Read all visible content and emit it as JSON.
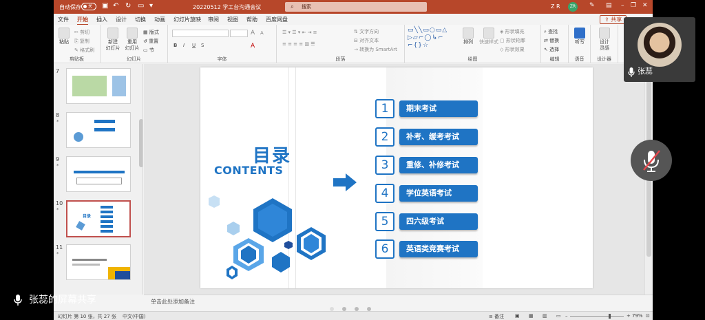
{
  "window": {
    "autosave_label": "自动保存",
    "autosave_state": "关",
    "doc_title": "20220512 学工台沟通会议",
    "search_placeholder": "搜索",
    "user_initials": "Z R",
    "avatar_initials": "ZR"
  },
  "tabs": [
    "文件",
    "开始",
    "插入",
    "设计",
    "切换",
    "动画",
    "幻灯片放映",
    "审阅",
    "视图",
    "帮助",
    "百度网盘"
  ],
  "active_tab": "开始",
  "share_label": "共享",
  "ribbon": {
    "clipboard": {
      "name": "剪贴板",
      "paste": "粘贴",
      "cut": "剪切",
      "copy": "复制",
      "format_painter": "格式刷"
    },
    "slides": {
      "name": "幻灯片",
      "new_slide": "新建\n幻灯片",
      "reuse": "重用\n幻灯片",
      "layout": "版式",
      "reset": "重置",
      "section": "节"
    },
    "font": {
      "name": "字体",
      "bold": "B",
      "italic": "I",
      "underline": "U",
      "strike": "S",
      "grow": "A",
      "shrink": "A"
    },
    "paragraph": {
      "name": "段落",
      "direction": "文字方向",
      "align": "对齐文本",
      "smartart": "转换为 SmartArt"
    },
    "drawing": {
      "name": "绘图",
      "arrange": "排列",
      "quick_styles": "快速样式",
      "fill": "形状填充",
      "outline": "形状轮廓",
      "effects": "形状效果"
    },
    "editing": {
      "name": "编辑",
      "find": "查找",
      "replace": "替换",
      "select": "选择"
    },
    "voice": {
      "name": "语音",
      "dictate": "听写"
    },
    "designer": {
      "name": "设计器",
      "ideas": "设计\n灵感"
    }
  },
  "thumbnails": [
    {
      "num": "7",
      "star": ""
    },
    {
      "num": "8",
      "star": "*"
    },
    {
      "num": "9",
      "star": "*"
    },
    {
      "num": "10",
      "star": "*"
    },
    {
      "num": "11",
      "star": "*"
    }
  ],
  "slide": {
    "title": "目录",
    "subtitle": "CONTENTS",
    "items": [
      {
        "num": "1",
        "label": "期末考试"
      },
      {
        "num": "2",
        "label": "补考、缓考考试"
      },
      {
        "num": "3",
        "label": "重修、补修考试"
      },
      {
        "num": "4",
        "label": "学位英语考试"
      },
      {
        "num": "5",
        "label": "四六级考试"
      },
      {
        "num": "6",
        "label": "英语类竞赛考试"
      }
    ]
  },
  "notes_placeholder": "单击此处添加备注",
  "status": {
    "slide_info": "幻灯片 第 10 张，共 27 张",
    "language": "中文(中国)",
    "notes": "备注",
    "zoom": "79%"
  },
  "meeting": {
    "participant_name": "张蕊",
    "share_label": "张蕊的屏幕共享"
  },
  "colors": {
    "accent": "#1f74c4",
    "titlebar": "#b7472a"
  }
}
